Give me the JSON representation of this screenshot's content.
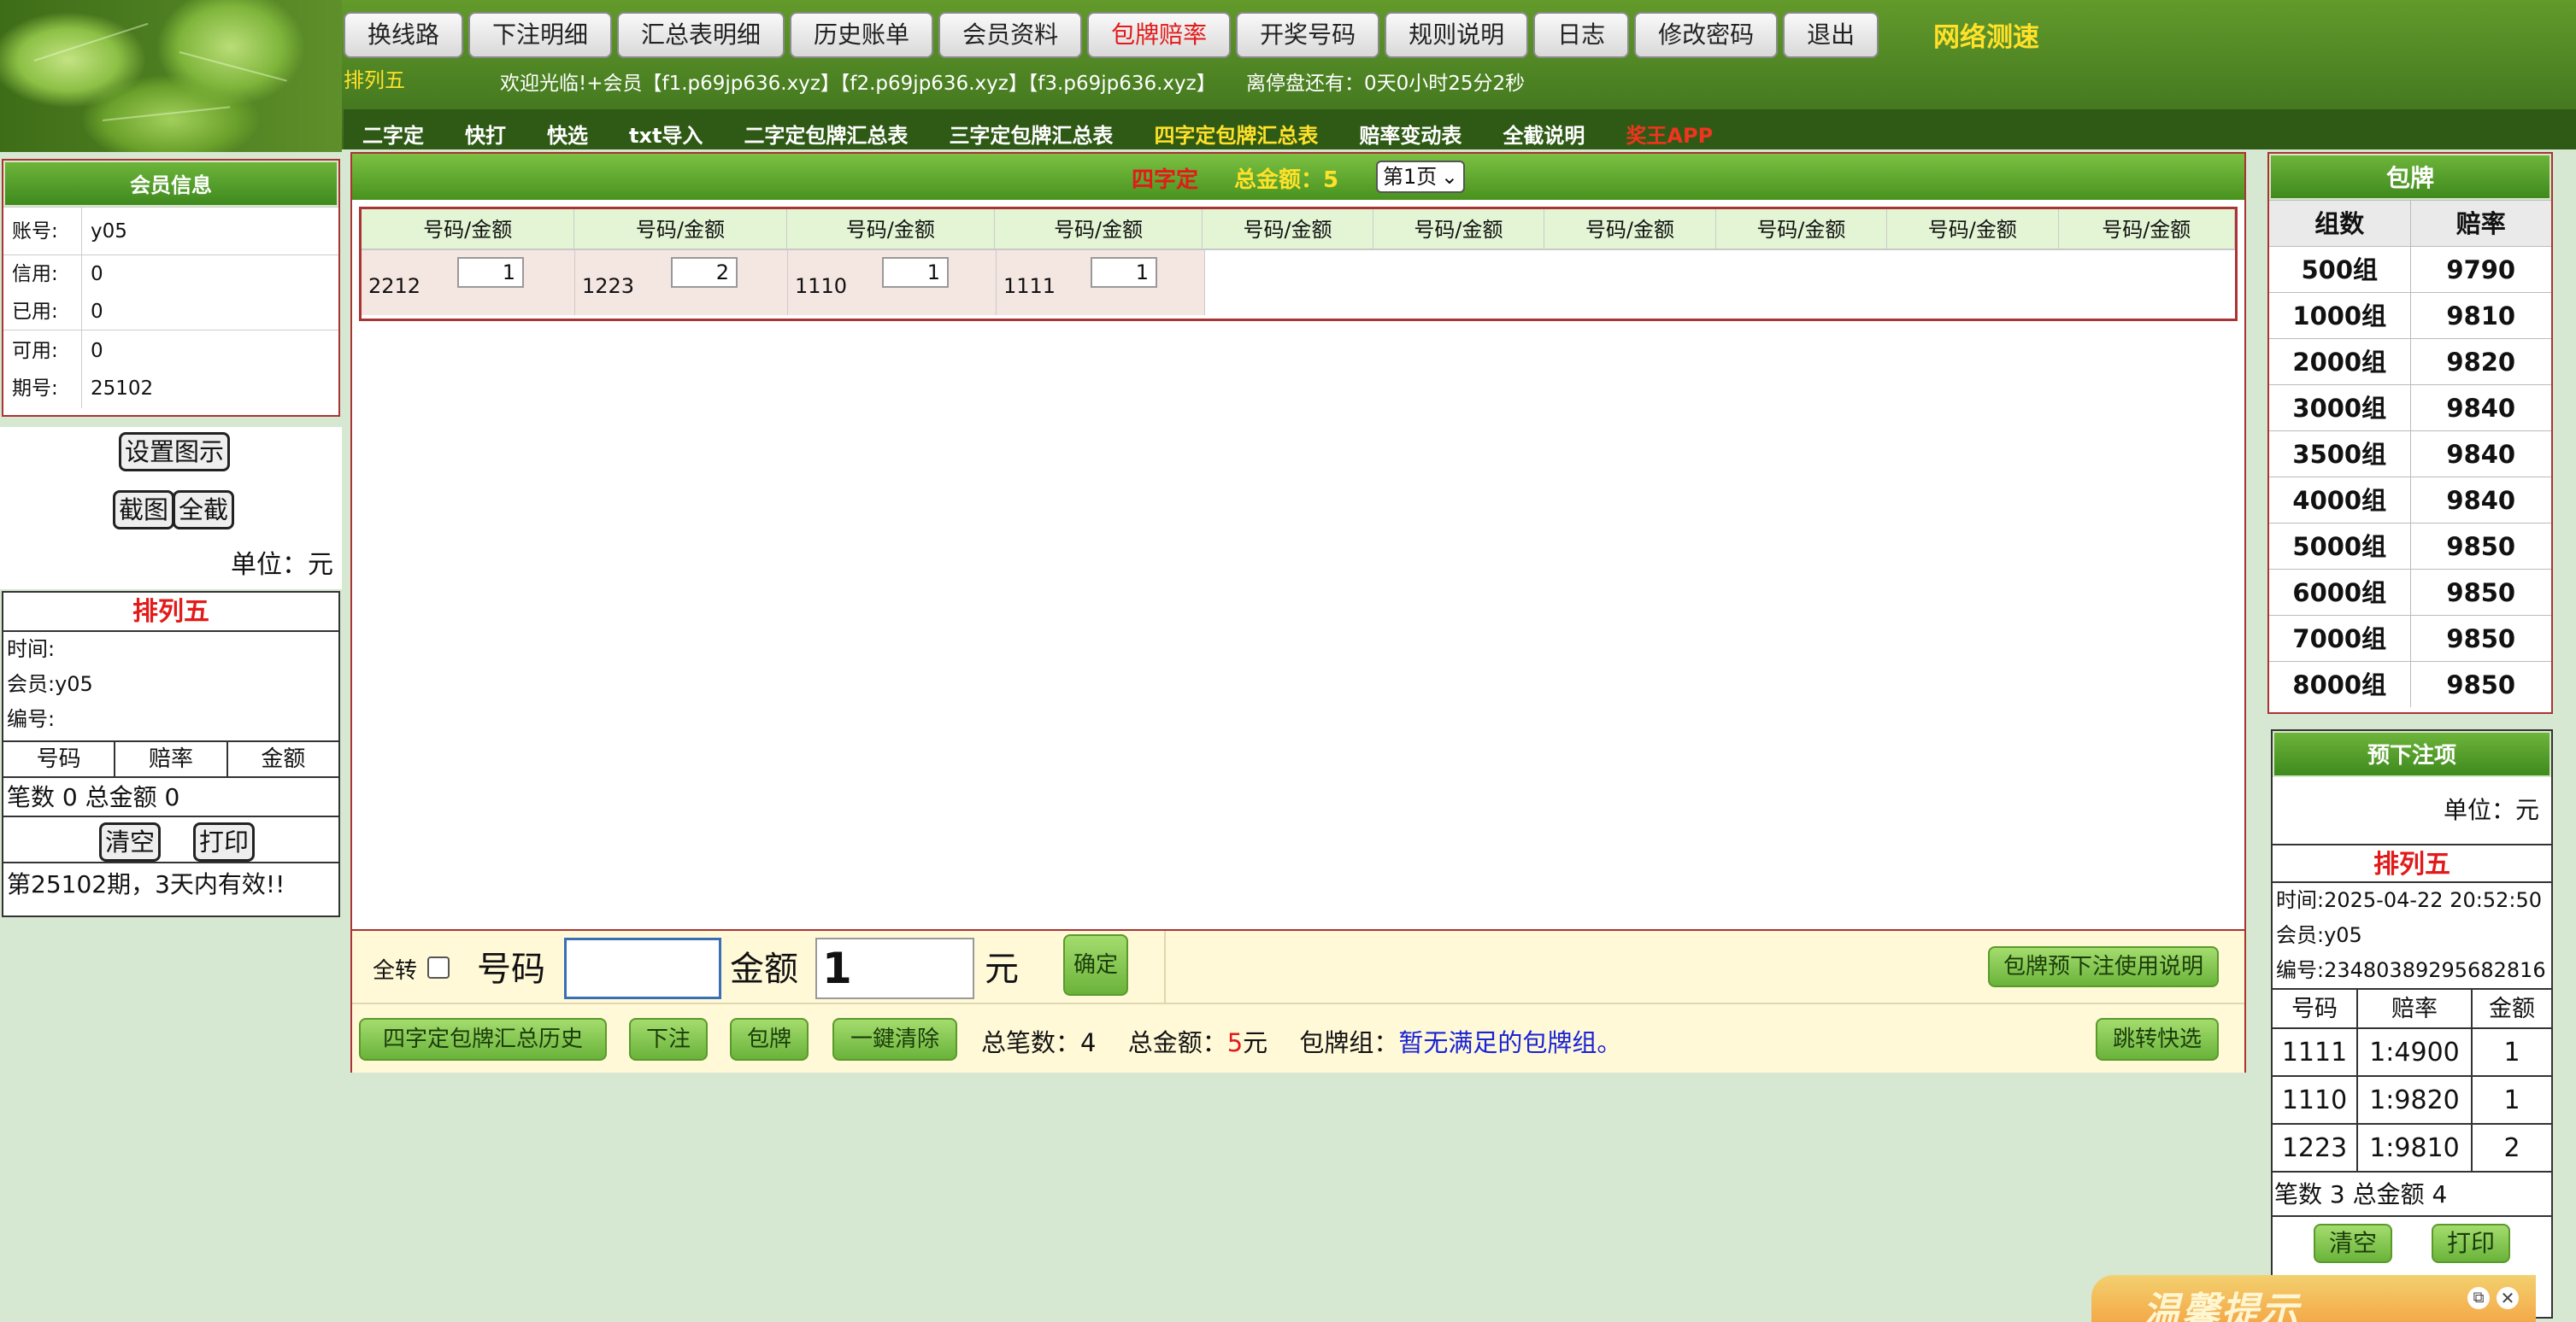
{
  "header": {
    "nav_buttons": [
      "换线路",
      "下注明细",
      "汇总表明细",
      "历史账单",
      "会员资料",
      "包牌赔率",
      "开奖号码",
      "规则说明",
      "日志",
      "修改密码",
      "退出"
    ],
    "speed_link": "网络测速",
    "lottery_name": "排列五",
    "welcome_text": "欢迎光临!+会员【f1.p69jp636.xyz】【f2.p69jp636.xyz】【f3.p69jp636.xyz】",
    "countdown": "离停盘还有：0天0小时25分2秒",
    "sub_nav": [
      "二字定",
      "快打",
      "快选",
      "txt导入",
      "二字定包牌汇总表",
      "三字定包牌汇总表",
      "四字定包牌汇总表",
      "赔率变动表",
      "全截说明",
      "奖王APP"
    ]
  },
  "member_info": {
    "title": "会员信息",
    "rows": [
      {
        "label": "账号:",
        "value": "y05"
      },
      {
        "label": "信用:",
        "value": "0"
      },
      {
        "label": "已用:",
        "value": "0"
      },
      {
        "label": "可用:",
        "value": "0"
      },
      {
        "label": "期号:",
        "value": "25102"
      }
    ]
  },
  "left_controls": {
    "settings_btn": "设置图示",
    "screenshot_btn": "截图",
    "fullshot_btn": "全截",
    "unit_text": "单位：元"
  },
  "left_ticket": {
    "title": "排列五",
    "time_label": "时间:",
    "member_label": "会员:y05",
    "number_label": "编号:",
    "columns": [
      "号码",
      "赔率",
      "金额"
    ],
    "summary": "笔数 0 总金额 0",
    "clear_btn": "清空",
    "print_btn": "打印",
    "valid_note": "第25102期，3天内有效!!"
  },
  "main": {
    "mode": "四字定",
    "total_label": "总金额：",
    "total_value": "5",
    "page_select": "第1页",
    "column_header": "号码/金额",
    "bets": [
      {
        "number": "2212",
        "amount": "1"
      },
      {
        "number": "1223",
        "amount": "2"
      },
      {
        "number": "1110",
        "amount": "1"
      },
      {
        "number": "1111",
        "amount": "1"
      }
    ],
    "input_bar": {
      "all_label": "全转",
      "number_label": "号码",
      "amount_label": "金额",
      "amount_value": "1",
      "unit": "元",
      "confirm_btn": "确定",
      "help_btn": "包牌预下注使用说明"
    },
    "action_bar": {
      "history_btn": "四字定包牌汇总历史",
      "bet_btn": "下注",
      "package_btn": "包牌",
      "clear_btn": "一鍵清除",
      "count_label": "总笔数：",
      "count_value": "4",
      "amount_label": "总金额：",
      "amount_value": "5",
      "amount_unit": "元",
      "group_label": "包牌组：",
      "group_value": "暂无满足的包牌组。",
      "jump_btn": "跳转快选"
    }
  },
  "package_odds": {
    "title": "包牌",
    "columns": [
      "组数",
      "赔率"
    ],
    "rows": [
      {
        "groups": "500组",
        "odds": "9790"
      },
      {
        "groups": "1000组",
        "odds": "9810"
      },
      {
        "groups": "2000组",
        "odds": "9820"
      },
      {
        "groups": "3000组",
        "odds": "9840"
      },
      {
        "groups": "3500组",
        "odds": "9840"
      },
      {
        "groups": "4000组",
        "odds": "9840"
      },
      {
        "groups": "5000组",
        "odds": "9850"
      },
      {
        "groups": "6000组",
        "odds": "9850"
      },
      {
        "groups": "7000组",
        "odds": "9850"
      },
      {
        "groups": "8000组",
        "odds": "9850"
      }
    ]
  },
  "pre_bet": {
    "title": "预下注项",
    "unit_text": "单位：元",
    "lottery": "排列五",
    "time": "时间:2025-04-22 20:52:50",
    "member": "会员:y05",
    "serial": "编号:23480389295682816",
    "columns": [
      "号码",
      "赔率",
      "金额"
    ],
    "rows": [
      {
        "number": "1111",
        "odds": "1:4900",
        "amount": "1"
      },
      {
        "number": "1110",
        "odds": "1:9820",
        "amount": "1"
      },
      {
        "number": "1223",
        "odds": "1:9810",
        "amount": "2"
      }
    ],
    "summary": "笔数 3 总金额 4",
    "clear_btn": "清空",
    "print_btn": "打印"
  },
  "popup": {
    "title": "温馨提示"
  }
}
